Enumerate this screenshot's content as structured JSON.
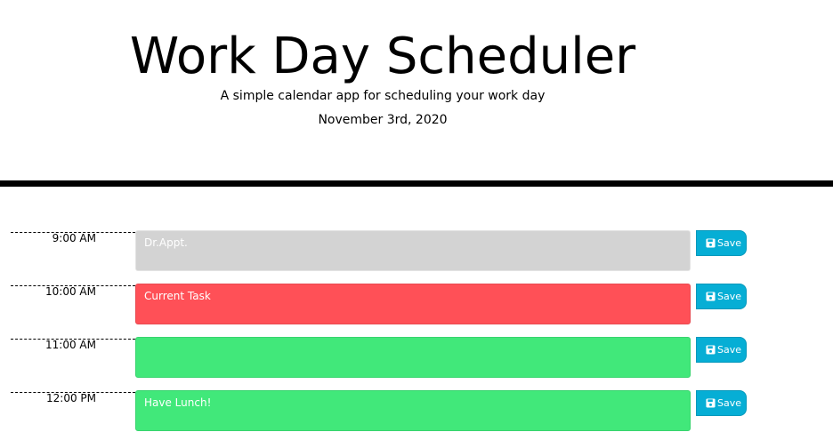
{
  "header": {
    "title": "Work Day Scheduler",
    "subtitle": "A simple calendar app for scheduling your work day",
    "current_day": "November 3rd, 2020"
  },
  "colors": {
    "past": "#d3d3d3",
    "present": "#ff5057",
    "future": "#41e87a",
    "save": "#06aed5"
  },
  "time_blocks": [
    {
      "hour": "9:00 AM",
      "text": "Dr.Appt.",
      "state": "past",
      "save_label": "Save",
      "save_icon": "floppy-disk-icon"
    },
    {
      "hour": "10:00 AM",
      "text": "Current Task",
      "state": "present",
      "save_label": "Save",
      "save_icon": "floppy-disk-icon"
    },
    {
      "hour": "11:00 AM",
      "text": "",
      "state": "future",
      "save_label": "Save",
      "save_icon": "floppy-disk-icon"
    },
    {
      "hour": "12:00 PM",
      "text": "Have Lunch!",
      "state": "future",
      "save_label": "Save",
      "save_icon": "floppy-disk-icon"
    }
  ]
}
